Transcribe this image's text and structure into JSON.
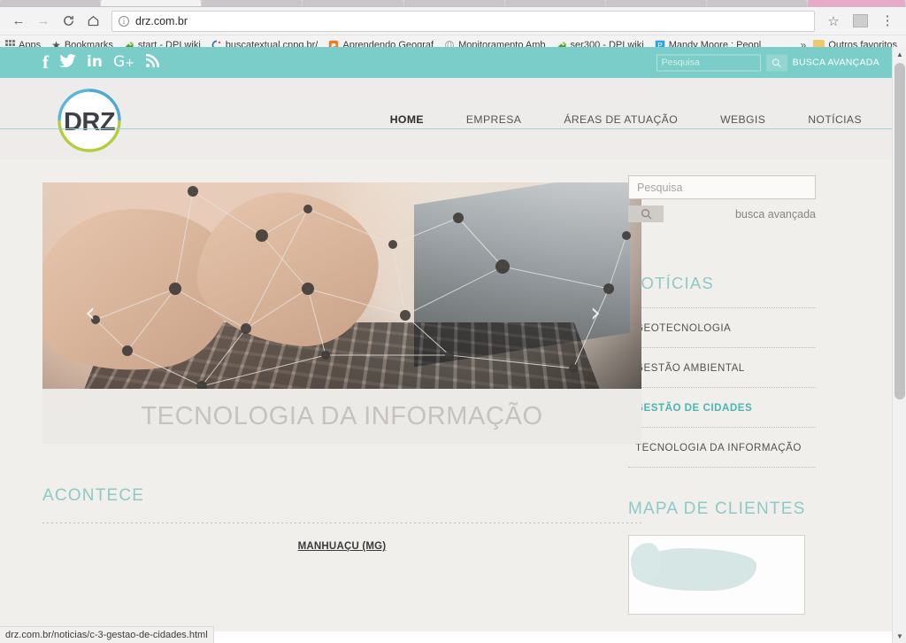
{
  "browser": {
    "url": "drz.com.br",
    "nav": {
      "back": "←",
      "forward": "→",
      "reload": "C",
      "home": "⌂",
      "star": "☆",
      "menu": "⋮"
    },
    "bookmarks": [
      {
        "label": "Apps",
        "icon": "grid-icon"
      },
      {
        "label": "Bookmarks",
        "icon": "star-icon"
      },
      {
        "label": "start - DPI wiki",
        "icon": "wiki-icon"
      },
      {
        "label": "buscatextual.cnpq.br/",
        "icon": "cnpq-icon"
      },
      {
        "label": "Aprendendo Geograf",
        "icon": "blog-icon"
      },
      {
        "label": "Monitoramento Amb",
        "icon": "globe-icon"
      },
      {
        "label": "ser300 - DPI wiki",
        "icon": "wiki-icon"
      },
      {
        "label": "Mandy Moore : Peopl",
        "icon": "people-icon"
      }
    ],
    "overflow_label": "»",
    "other_bookmarks": "Outros favoritos",
    "status_url": "drz.com.br/noticias/c-3-gestao-de-cidades.html"
  },
  "topbar": {
    "socials": [
      {
        "name": "facebook-icon",
        "glyph": "f"
      },
      {
        "name": "twitter-icon",
        "glyph": "🐦"
      },
      {
        "name": "linkedin-icon",
        "glyph": "in"
      },
      {
        "name": "googleplus-icon",
        "glyph": "G+"
      },
      {
        "name": "rss-icon",
        "glyph": "🔊"
      }
    ],
    "search_placeholder": "Pesquisa",
    "search_value": "",
    "search_button_icon": "search-icon",
    "advanced_label": "BUSCA AVANÇADA"
  },
  "header": {
    "logo_text": "DRZ",
    "nav": [
      {
        "label": "HOME",
        "active": true
      },
      {
        "label": "EMPRESA",
        "active": false
      },
      {
        "label": "ÁREAS DE ATUAÇÃO",
        "active": false
      },
      {
        "label": "WEBGIS",
        "active": false
      },
      {
        "label": "NOTÍCIAS",
        "active": false
      }
    ]
  },
  "carousel": {
    "caption": "TECNOLOGIA DA INFORMAÇÃO",
    "prev_icon": "‹",
    "next_icon": "›"
  },
  "main": {
    "acontece_title": "ACONTECE",
    "news_city": "MANHUAÇU (MG)"
  },
  "sidebar": {
    "search_placeholder": "Pesquisa",
    "search_value": "",
    "search_button_icon": "search-icon",
    "advanced_label": "busca avançada",
    "noticias_title": "NOTÍCIAS",
    "categories": [
      {
        "label": "GEOTECNOLOGIA",
        "active": false
      },
      {
        "label": "GESTÃO AMBIENTAL",
        "active": false
      },
      {
        "label": "GESTÃO DE CIDADES",
        "active": true
      },
      {
        "label": "TECNOLOGIA DA INFORMAÇÃO",
        "active": false
      }
    ],
    "mapa_title": "MAPA DE CLIENTES"
  },
  "colors": {
    "teal": "#7ACDC8",
    "teal_text": "#8dc9c5",
    "active_link": "#4bb5ae",
    "page_bg": "#f1efec",
    "header_bg": "#eeecea",
    "logo_blue": "#4fa9d4",
    "logo_green": "#b5cc3c",
    "logo_dark": "#3d4145"
  }
}
